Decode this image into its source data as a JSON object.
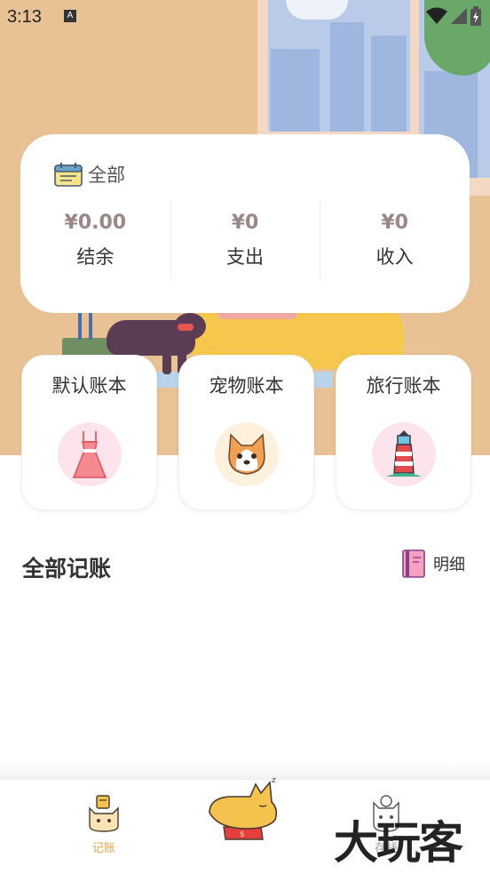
{
  "status_bar": {
    "time": "3:13",
    "a_icon": "A"
  },
  "summary": {
    "book_label": "全部",
    "stats": [
      {
        "value": "¥0.00",
        "label": "结余"
      },
      {
        "value": "¥0",
        "label": "支出"
      },
      {
        "value": "¥0",
        "label": "收入"
      }
    ]
  },
  "books": [
    {
      "title": "默认账本",
      "icon": "dress-icon",
      "bg": "#fde3ec"
    },
    {
      "title": "宠物账本",
      "icon": "corgi-icon",
      "bg": "#fdf0dc"
    },
    {
      "title": "旅行账本",
      "icon": "lighthouse-icon",
      "bg": "#fde3ec"
    }
  ],
  "section": {
    "title": "全部记账",
    "detail_label": "明细"
  },
  "nav": {
    "ledger_label": "记账",
    "save_label": "存钱"
  },
  "watermark": "大玩客",
  "colors": {
    "accent": "#e3a54a",
    "hero_bg": "#e8c294",
    "stat_value": "#9a8787"
  }
}
